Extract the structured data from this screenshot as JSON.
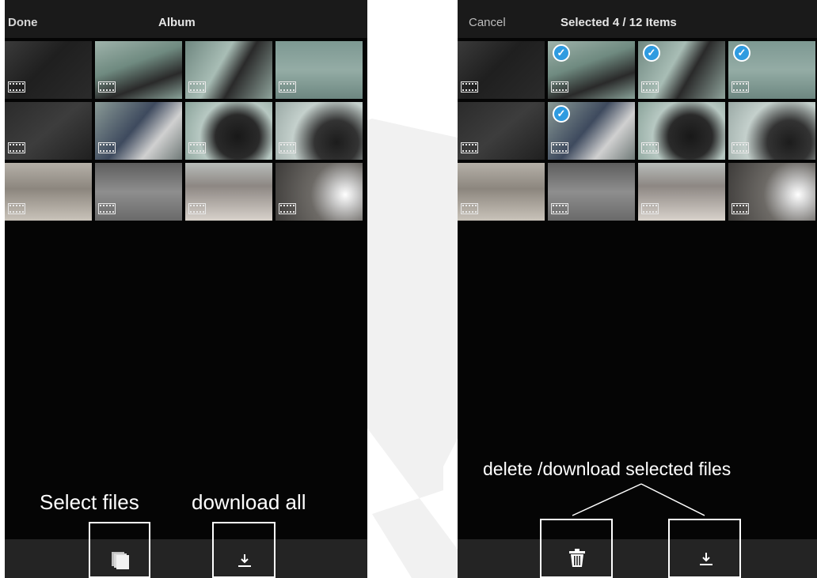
{
  "left_screen": {
    "nav_done": "Done",
    "title": "Album",
    "annotation_select": "Select files",
    "annotation_download": "download all"
  },
  "right_screen": {
    "nav_cancel": "Cancel",
    "title": "Selected 4 / 12 Items",
    "annotation": "delete /download selected files"
  },
  "thumbnails": [
    {
      "bg": "linear-gradient(135deg,#3a3a3a 0%,#1f1f1f 45%,#2b2b2b 100%)",
      "selected": false
    },
    {
      "bg": "linear-gradient(160deg,#9fb3ab 0%,#6f8a80 40%,#2a2a2a 70%,#8aa39a 100%)",
      "selected": true
    },
    {
      "bg": "linear-gradient(120deg,#6f8780 0%,#a8bdb5 40%,#2a2a2a 60%,#8fa49c 100%)",
      "selected": true
    },
    {
      "bg": "linear-gradient(180deg,#7d9892 0%,#94aca5 50%,#6d8781 100%)",
      "selected": true
    },
    {
      "bg": "linear-gradient(140deg,#2b2b2b 0%,#3d3d3d 50%,#202020 100%)",
      "selected": false
    },
    {
      "bg": "linear-gradient(130deg,#8a9a96 0%,#3e4a5e 45%,#d0d0d0 70%,#707a78 100%)",
      "selected": true
    },
    {
      "bg": "radial-gradient(circle at 60% 60%,#181818 0%,#2a2a2a 35%,#b7c8c2 60%,#8aa39a 100%)",
      "selected": false
    },
    {
      "bg": "radial-gradient(circle at 70% 70%,#1c1c1c 0%,#333 30%,#c4d0cc 60%,#9aa9a5 100%)",
      "selected": false
    },
    {
      "bg": "linear-gradient(180deg,#b5b0a8 0%,#8c867e 45%,#c9c3ba 100%)",
      "selected": false
    },
    {
      "bg": "linear-gradient(180deg,#5e5e5e 0%,#8e8e8e 50%,#6a6a6a 100%)",
      "selected": false
    },
    {
      "bg": "linear-gradient(180deg,#b8bcb9 0%,#8d8783 40%,#d8d2cb 100%)",
      "selected": false
    },
    {
      "bg": "radial-gradient(circle at 80% 55%,#ffffff 0%,#cfcfcf 15%,#6d6a66 45%,#3e3c3a 100%)",
      "selected": false
    }
  ],
  "icons": {
    "watermark": "brand-watermark-icon",
    "select": "stack-icon",
    "download": "download-icon",
    "delete": "trash-icon"
  }
}
